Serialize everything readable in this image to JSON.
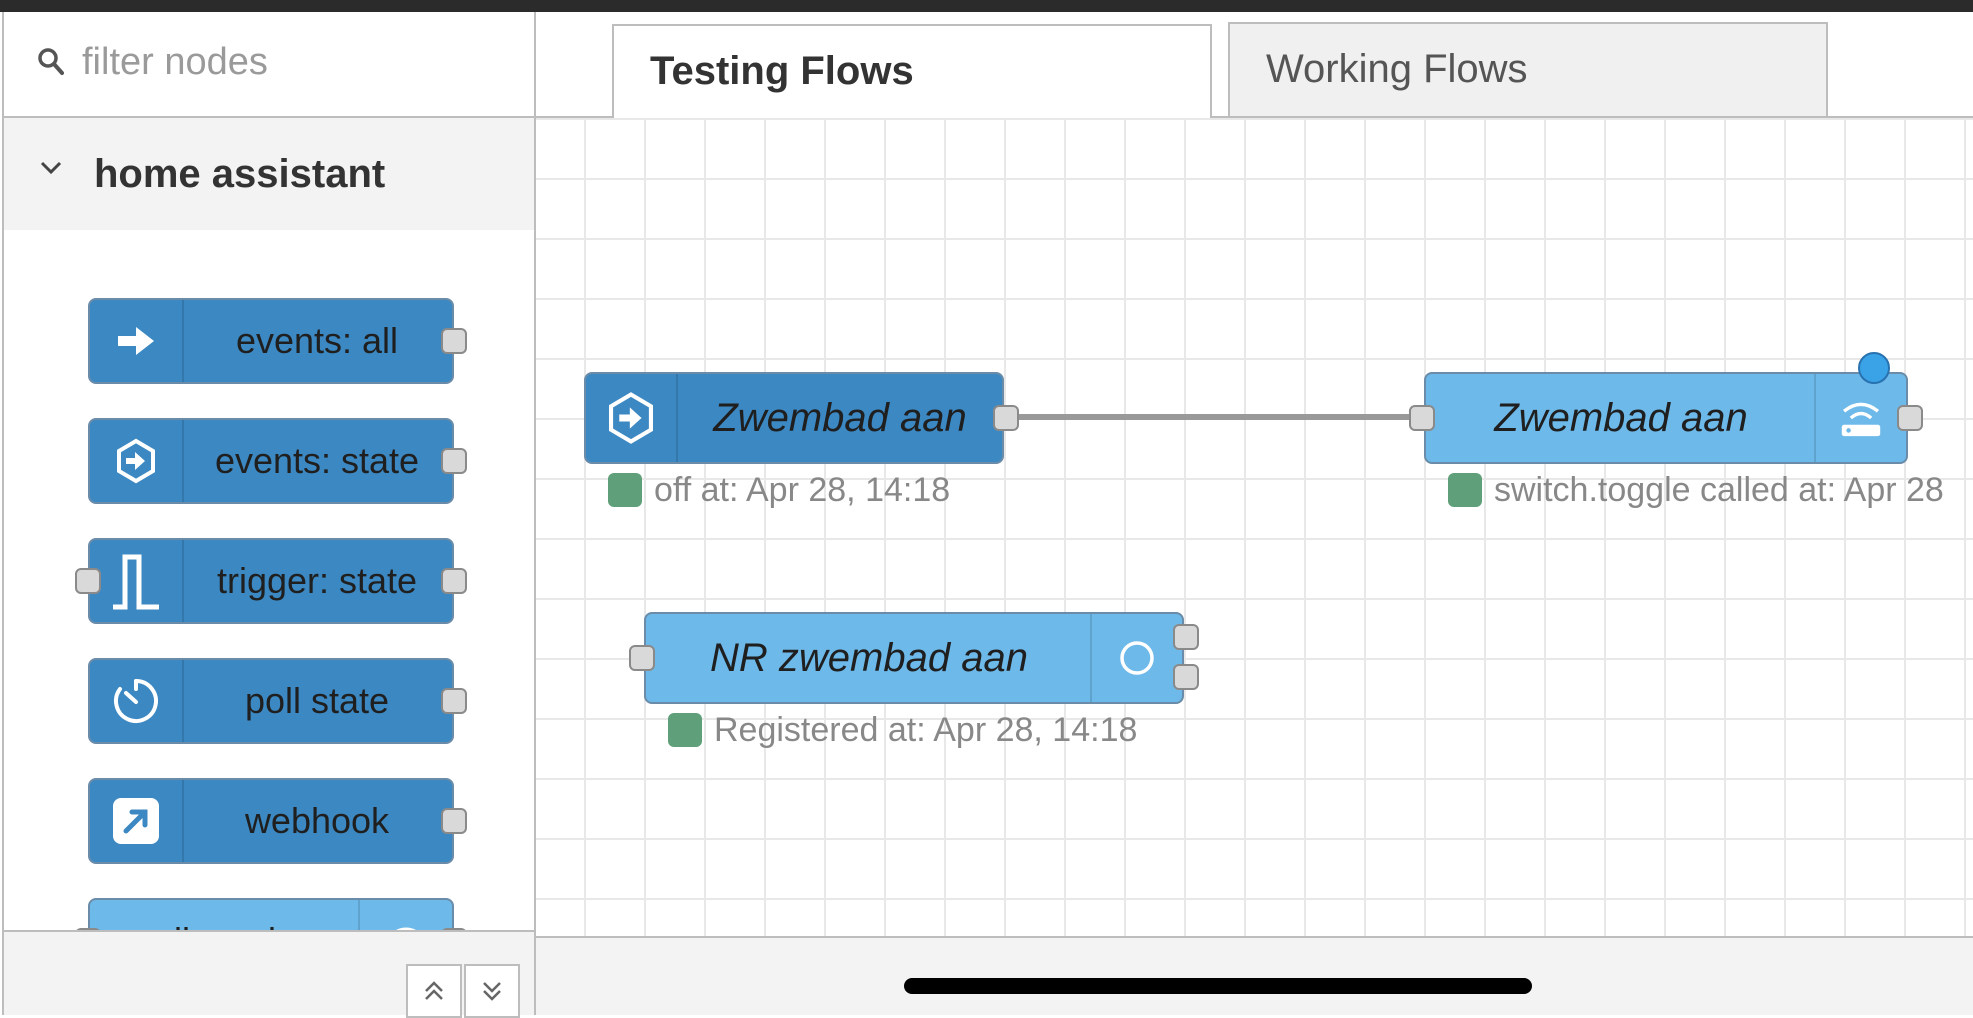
{
  "palette": {
    "filter_placeholder": "filter nodes",
    "category_title": "home assistant",
    "nodes": [
      {
        "label": "events: all",
        "icon": "arrow-right-icon",
        "style": "dark"
      },
      {
        "label": "events: state",
        "icon": "arrow-circle-icon",
        "style": "dark"
      },
      {
        "label": "trigger: state",
        "icon": "trigger-pulse-icon",
        "style": "dark"
      },
      {
        "label": "poll state",
        "icon": "timer-icon",
        "style": "dark"
      },
      {
        "label": "webhook",
        "icon": "external-link-icon",
        "style": "dark"
      },
      {
        "label": "call service",
        "icon": "router-icon",
        "style": "light"
      }
    ]
  },
  "tabs": [
    {
      "label": "Testing Flows",
      "active": true
    },
    {
      "label": "Working Flows",
      "active": false
    }
  ],
  "flow": {
    "nodes": [
      {
        "label": "Zwembad aan",
        "status": "off at: Apr 28, 14:18",
        "style": "dark",
        "icon": "arrow-circle-icon"
      },
      {
        "label": "Zwembad aan",
        "status": "switch.toggle called at: Apr 28",
        "style": "light",
        "icon": "router-icon"
      },
      {
        "label": "NR zwembad aan",
        "status": "Registered at: Apr 28, 14:18",
        "style": "light",
        "icon": "circle-icon"
      }
    ]
  },
  "colors": {
    "node_dark": "#3c88c2",
    "node_light": "#6db9ea",
    "status_green": "#5f9f7a",
    "changed_badge": "#3aa3e8"
  }
}
